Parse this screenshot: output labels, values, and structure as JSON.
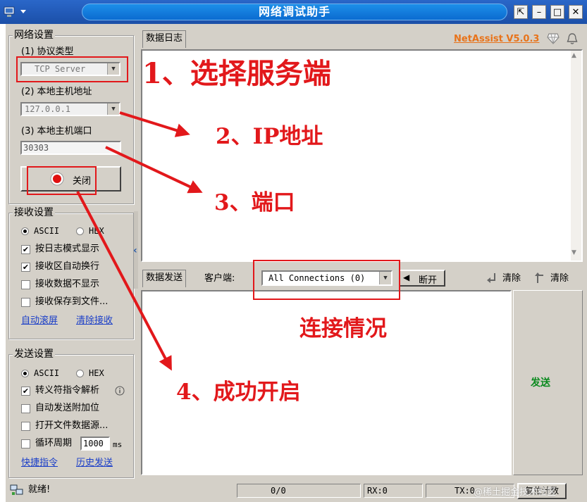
{
  "window": {
    "title": "网络调试助手",
    "minimize": "–",
    "maximize": "□",
    "close": "✕",
    "pin": "⇱"
  },
  "net_settings": {
    "group_title": "网络设置",
    "protocol_label": "(1) 协议类型",
    "protocol_value": "TCP Server",
    "host_label": "(2) 本地主机地址",
    "host_value": "127.0.0.1",
    "port_label": "(3) 本地主机端口",
    "port_value": "30303",
    "toggle_label": "关闭"
  },
  "recv_settings": {
    "group_title": "接收设置",
    "ascii": "ASCII",
    "hex": "HEX",
    "opt_log_mode": "按日志模式显示",
    "opt_auto_wrap": "接收区自动换行",
    "opt_no_display": "接收数据不显示",
    "opt_save_file": "接收保存到文件...",
    "link_auto_scroll": "自动滚屏",
    "link_clear_recv": "清除接收"
  },
  "send_settings": {
    "group_title": "发送设置",
    "ascii": "ASCII",
    "hex": "HEX",
    "opt_escape": "转义符指令解析",
    "opt_auto_append": "自动发送附加位",
    "opt_open_file": "打开文件数据源...",
    "opt_loop": "循环周期",
    "loop_value": "1000",
    "loop_unit": "ms",
    "link_shortcuts": "快捷指令",
    "link_history": "历史发送"
  },
  "log_panel": {
    "tab": "数据日志",
    "brand": "NetAssist V5.0.3"
  },
  "send_panel": {
    "tab": "数据发送",
    "client_label": "客户端:",
    "connections": "All Connections (0)",
    "disconnect": "断开",
    "clear1": "清除",
    "clear2": "清除",
    "send": "发送"
  },
  "statusbar": {
    "status": "就绪!",
    "counter": "0/0",
    "rx": "RX:0",
    "tx": "TX:0",
    "reset": "复位计数"
  },
  "watermark": "@稀土掘金技术社区",
  "annotations": {
    "a1": "1、选择服务端",
    "a2": "2、IP地址",
    "a3": "3、端口",
    "a4": "4、成功开启",
    "a5": "连接情况"
  },
  "colors": {
    "annotation": "#e2181b",
    "link": "#1a3ec8",
    "brand": "#e8731a",
    "send": "#0a8a1e"
  }
}
